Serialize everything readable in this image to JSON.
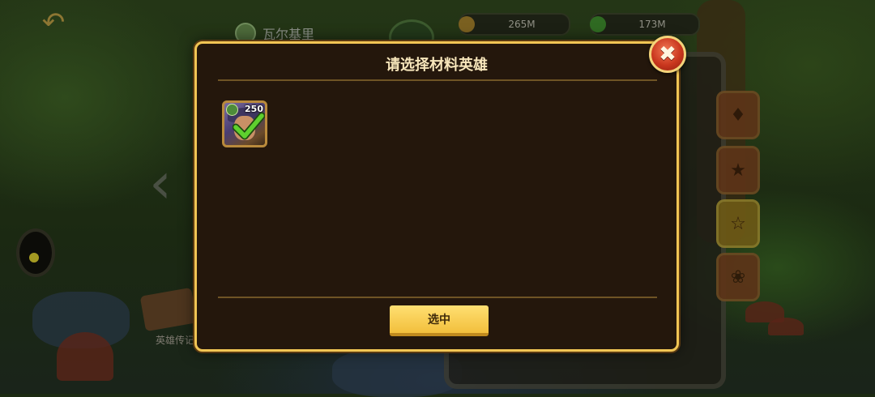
{
  "background": {
    "location_name": "瓦尔基里",
    "resource_1": "265M",
    "resource_2": "173M",
    "book_label": "英雄传记"
  },
  "dialog": {
    "title": "请选择材料英雄",
    "hero": {
      "level": "250",
      "selected": true
    },
    "select_button_label": "选中",
    "close_icon": "close-icon"
  },
  "colors": {
    "accent_gold": "#f1c554",
    "panel_brown": "#24170c",
    "button_yellow": "#f2bf3c",
    "close_red": "#c9361e",
    "check_green": "#4fc12a"
  }
}
